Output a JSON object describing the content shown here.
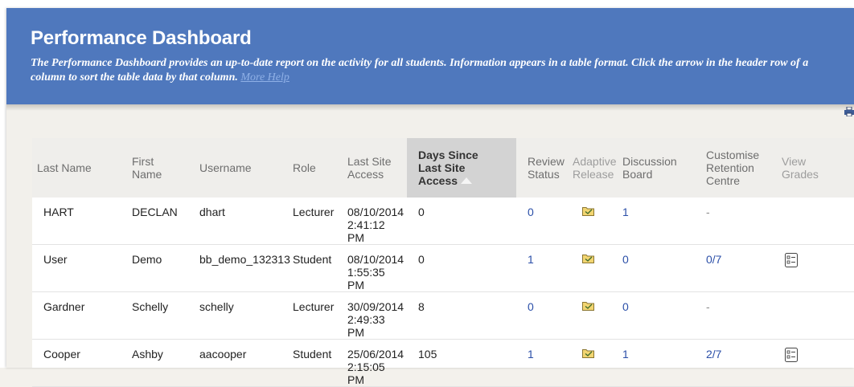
{
  "header": {
    "title": "Performance Dashboard",
    "description": "The Performance Dashboard provides an up-to-date report on the activity for all students. Information appears in a table format. Click the arrow in the header row of a column to sort the table data by that column.",
    "help_link": "More Help"
  },
  "table": {
    "columns": {
      "last_name": "Last Name",
      "first_name_1": "First",
      "first_name_2": "Name",
      "username": "Username",
      "role": "Role",
      "last_access_1": "Last Site",
      "last_access_2": "Access",
      "days_1": "Days Since",
      "days_2": "Last Site",
      "days_3": "Access",
      "review_1": "Review",
      "review_2": "Status",
      "adaptive_1": "Adaptive",
      "adaptive_2": "Release",
      "discussion_1": "Discussion",
      "discussion_2": "Board",
      "retention_1": "Customise",
      "retention_2": "Retention",
      "retention_3": "Centre",
      "grades_1": "View",
      "grades_2": "Grades"
    },
    "rows": [
      {
        "last": "HART",
        "first": "DECLAN",
        "user": "dhart",
        "role": "Lecturer",
        "date": "08/10/2014",
        "time": "2:41:12 PM",
        "days": "0",
        "review": "0",
        "discussion": "1",
        "retention": "-"
      },
      {
        "last": "User",
        "first": "Demo",
        "user": "bb_demo_132313",
        "role": "Student",
        "date": "08/10/2014",
        "time": "1:55:35 PM",
        "days": "0",
        "review": "1",
        "discussion": "0",
        "retention": "0/7"
      },
      {
        "last": "Gardner",
        "first": "Schelly",
        "user": "schelly",
        "role": "Lecturer",
        "date": "30/09/2014",
        "time": "2:49:33 PM",
        "days": "8",
        "review": "0",
        "discussion": "0",
        "retention": "-"
      },
      {
        "last": "Cooper",
        "first": "Ashby",
        "user": "aacooper",
        "role": "Student",
        "date": "25/06/2014",
        "time": "2:15:05 PM",
        "days": "105",
        "review": "1",
        "discussion": "1",
        "retention": "2/7"
      }
    ]
  },
  "icons": {
    "adaptive_release": "folder-check-icon",
    "view_grades": "grade-list-icon",
    "print": "print-icon",
    "sort": "sort-ascending-icon"
  },
  "colors": {
    "header_bg": "#4f78bd",
    "link": "#2b4fa8",
    "sorted_header": "#d3d3d3"
  }
}
